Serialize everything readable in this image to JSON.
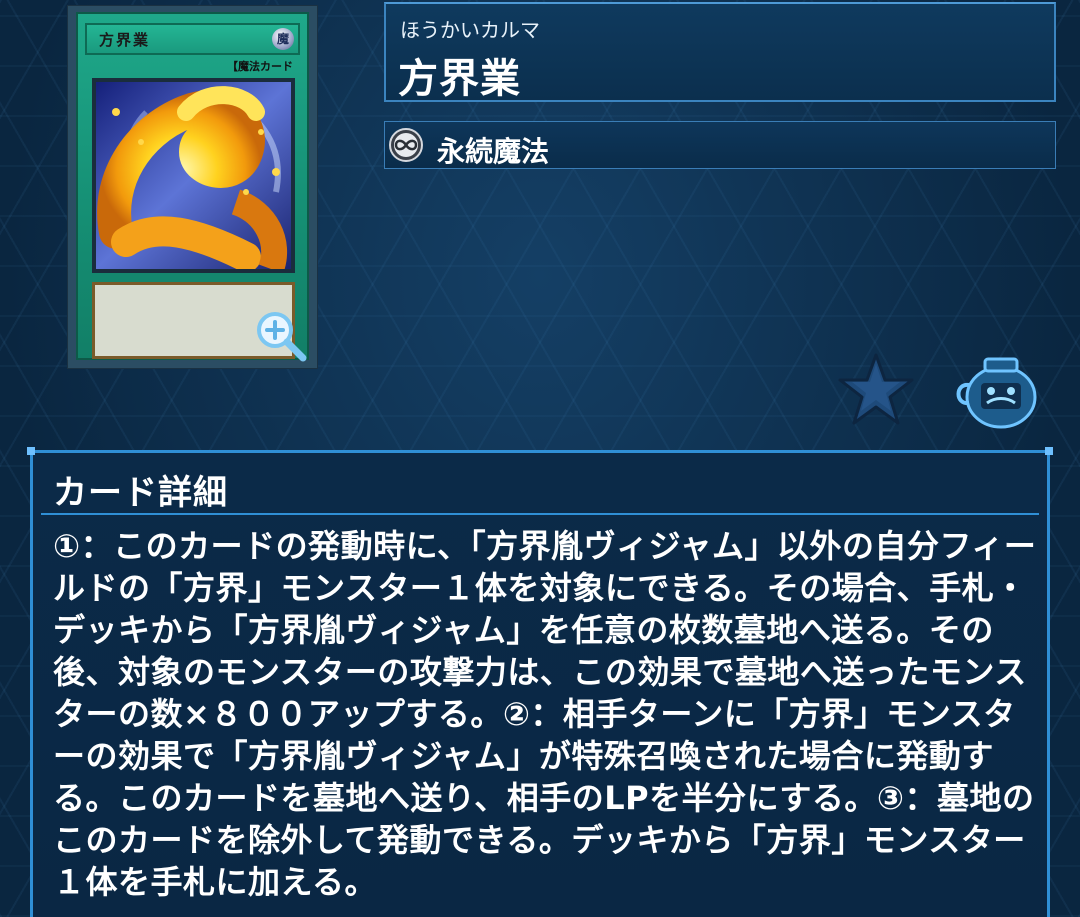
{
  "card": {
    "image_name": "方界業",
    "image_type_line": "【魔法カード",
    "attribute_glyph": "魔"
  },
  "header": {
    "ruby": "ほうかいカルマ",
    "name": "方界業"
  },
  "type": {
    "icon": "continuous-spell-icon",
    "label": "永続魔法"
  },
  "actions": {
    "favorite_icon": "star-icon",
    "deck_icon": "jar-icon",
    "zoom_icon": "zoom-in-icon"
  },
  "detail": {
    "title": "カード詳細",
    "text": "①：このカードの発動時に、「方界胤ヴィジャム」以外の自分フィールドの「方界」モンスター１体を対象にできる。その場合、手札・デッキから「方界胤ヴィジャム」を任意の枚数墓地へ送る。その後、対象のモンスターの攻撃力は、この効果で墓地へ送ったモンスターの数×８００アップする。②：相手ターンに「方界」モンスターの効果で「方界胤ヴィジャム」が特殊召喚された場合に発動する。このカードを墓地へ送り、相手のLPを半分にする。③：墓地のこのカードを除外して発動できる。デッキから「方界」モンスター１体を手札に加える。"
  },
  "colors": {
    "background": "#0a2640",
    "panel_border": "#2f8fd6",
    "spell_card_green": "#1fa88a"
  }
}
